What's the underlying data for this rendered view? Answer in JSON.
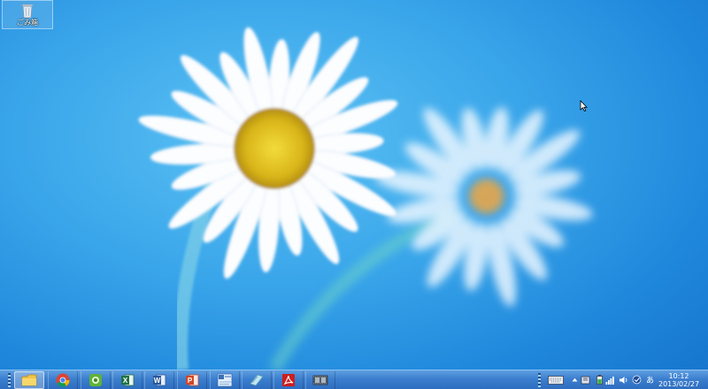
{
  "desktop": {
    "icons": [
      {
        "label": "ごみ箱",
        "icon": "recycle-bin-icon"
      }
    ]
  },
  "taskbar": {
    "pinned": [
      {
        "name": "file-explorer",
        "icon": "folder-icon"
      },
      {
        "name": "chrome",
        "icon": "chrome-icon"
      },
      {
        "name": "evernote",
        "icon": "evernote-icon"
      },
      {
        "name": "excel",
        "icon": "excel-icon",
        "glyph": "X"
      },
      {
        "name": "word",
        "icon": "word-icon",
        "glyph": "W"
      },
      {
        "name": "powerpoint",
        "icon": "powerpoint-icon",
        "glyph": "P"
      },
      {
        "name": "language-app",
        "icon": "language-icon"
      },
      {
        "name": "notes",
        "icon": "notes-icon"
      },
      {
        "name": "acrobat",
        "icon": "acrobat-icon"
      },
      {
        "name": "film-app",
        "icon": "film-icon"
      }
    ],
    "tray": {
      "icons": [
        "keyboard-icon",
        "show-hidden-icon",
        "action-center-icon",
        "battery-icon",
        "network-icon",
        "volume-icon",
        "sync-icon",
        "ime-icon"
      ],
      "ime_label": "あ",
      "clock_time": "10:12",
      "clock_date": "2013/02/27"
    }
  },
  "colors": {
    "sky": "#3aa6ea",
    "taskbar": "#3c7fcf",
    "excel": "#1e7145",
    "word": "#2b579a",
    "powerpoint": "#d24726",
    "acrobat": "#cc1f1f",
    "daisy_center": "#e7c51a"
  }
}
